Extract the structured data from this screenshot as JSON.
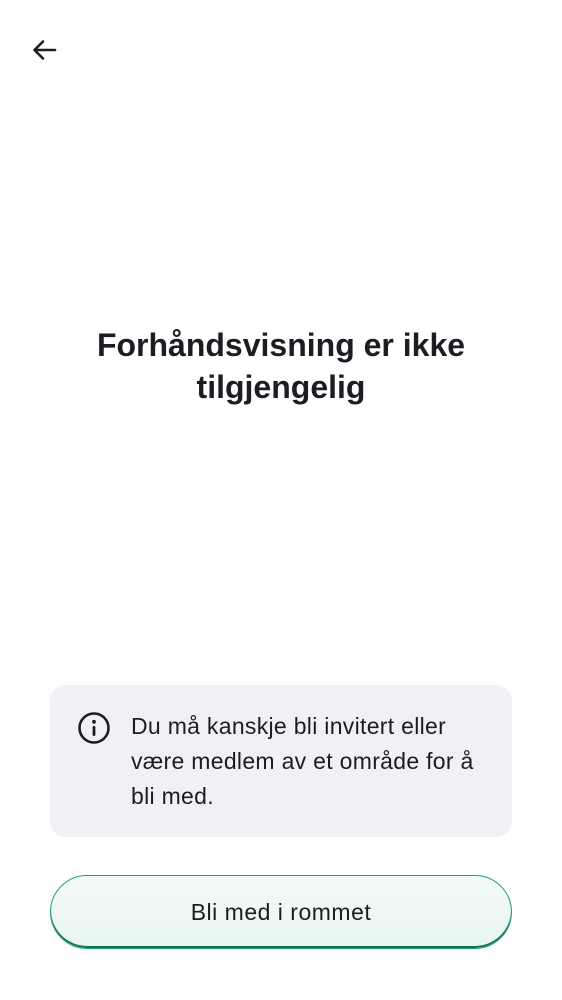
{
  "header": {
    "back_icon": "arrow-left-icon"
  },
  "main": {
    "title": "Forhåndsvisning er ikke tilgjengelig"
  },
  "info": {
    "icon": "info-circle-icon",
    "text": "Du må kanskje bli invitert eller være medlem av et område for å bli med."
  },
  "actions": {
    "join_label": "Bli med i rommet"
  },
  "colors": {
    "text": "#1b1d22",
    "card_background": "#f0f1f4",
    "accent": "#0d7355"
  }
}
